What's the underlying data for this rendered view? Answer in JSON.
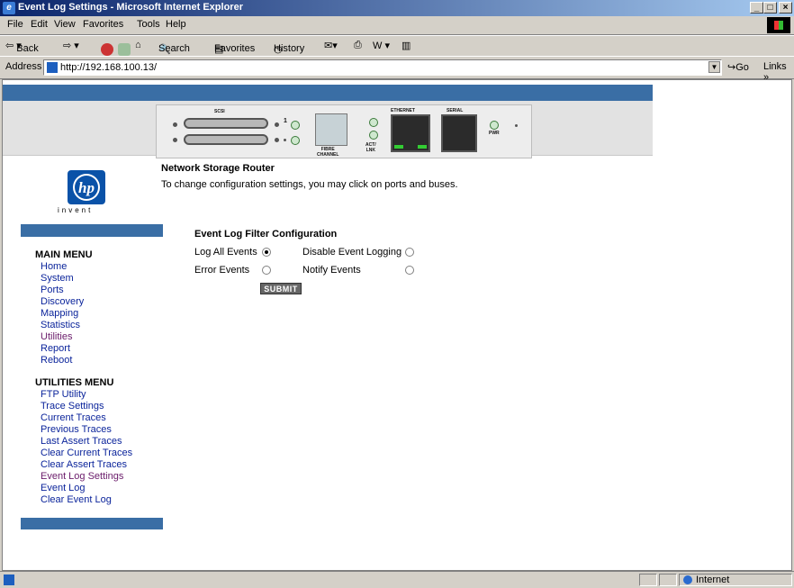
{
  "window": {
    "title": "Event Log Settings - Microsoft Internet Explorer",
    "controls": [
      "_",
      "□",
      "×"
    ]
  },
  "menubar": {
    "items": [
      "File",
      "Edit",
      "View",
      "Favorites",
      "Tools",
      "Help"
    ]
  },
  "toolbar": {
    "back": "Back",
    "search": "Search",
    "favorites": "Favorites",
    "history": "History"
  },
  "addressbar": {
    "label": "Address",
    "url": "http://192.168.100.13/",
    "go": "Go",
    "links": "Links »"
  },
  "router": {
    "labels": {
      "scsi": "SCSI",
      "fibre": "FIBRE\nCHANNEL",
      "act": "ACT/\nLNK",
      "ethernet": "ETHERNET",
      "serial": "SERIAL",
      "pwr": "PWR"
    },
    "port_numbers": [
      "1",
      "2"
    ]
  },
  "logo": {
    "text": "hp",
    "tagline": "invent"
  },
  "header": {
    "title": "Network Storage Router",
    "subtitle": "To change configuration settings, you may click on ports and buses."
  },
  "main_menu": {
    "title": "MAIN MENU",
    "items": [
      "Home",
      "System",
      "Ports",
      "Discovery",
      "Mapping",
      "Statistics",
      "Utilities",
      "Report",
      "Reboot"
    ]
  },
  "utilities_menu": {
    "title": "UTILITIES MENU",
    "items": [
      "FTP Utility",
      "Trace Settings",
      "Current Traces",
      "Previous Traces",
      "Last Assert Traces",
      "Clear Current Traces",
      "Clear Assert Traces",
      "Event Log Settings",
      "Event Log",
      "Clear Event Log"
    ]
  },
  "form": {
    "title": "Event Log Filter Configuration",
    "options": {
      "log_all": "Log All Events",
      "disable": "Disable Event Logging",
      "error": "Error Events",
      "notify": "Notify Events"
    },
    "selected": "log_all",
    "submit": "SUBMIT"
  },
  "statusbar": {
    "zone": "Internet"
  },
  "colors": {
    "accent": "#3a6ea5",
    "link": "#0b249b",
    "visited": "#6a1b6a"
  }
}
